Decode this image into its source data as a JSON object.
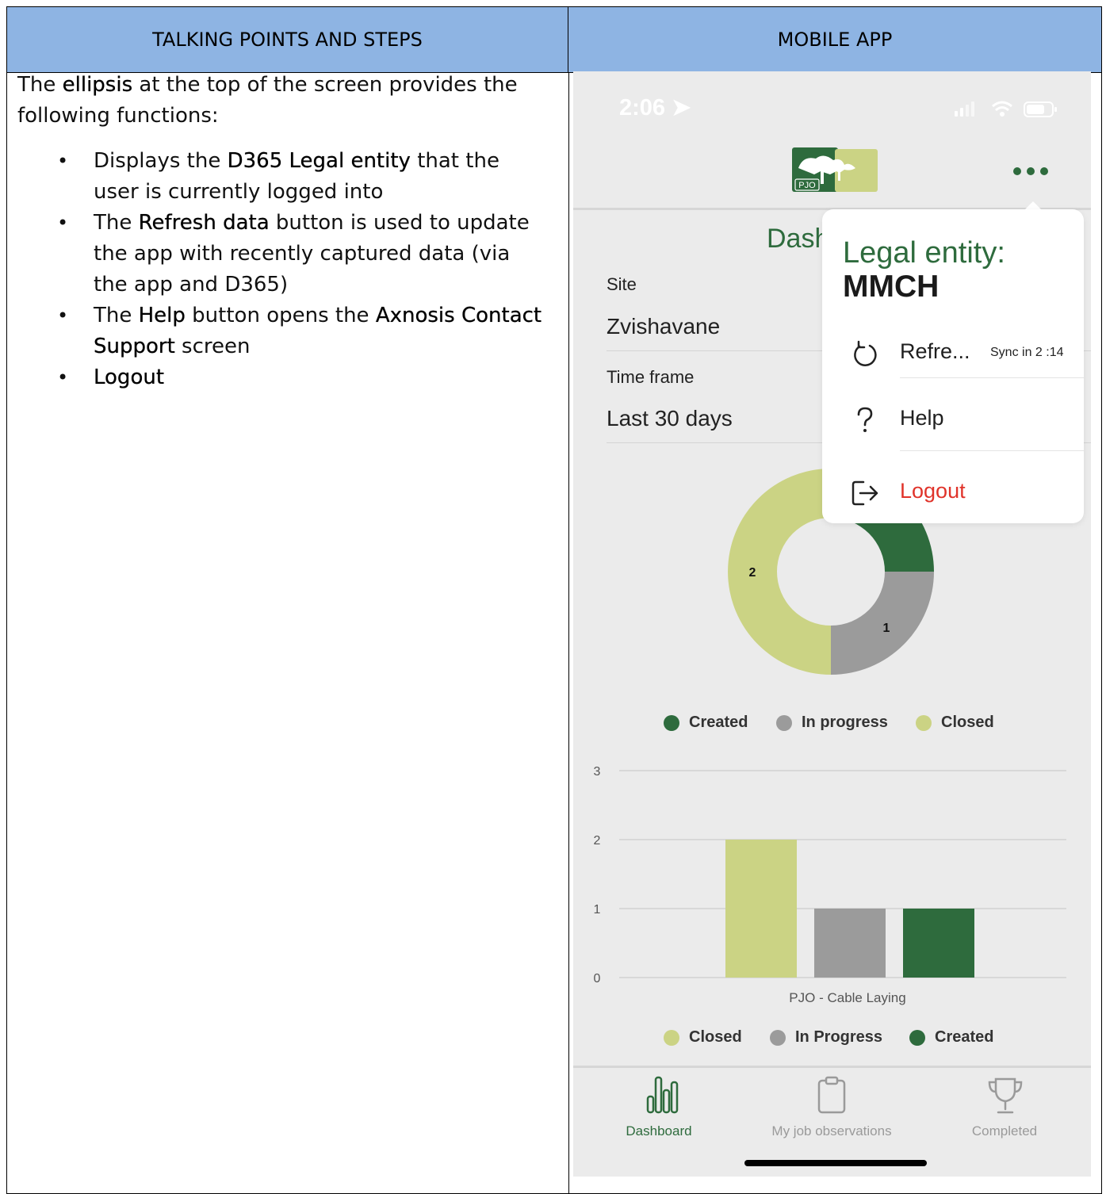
{
  "table": {
    "left_header": "TALKING POINTS AND STEPS",
    "right_header": "MOBILE APP"
  },
  "talking_points": {
    "intro_1": "The ",
    "intro_bold": "ellipsis",
    "intro_2": " at the top of the screen provides the following functions:",
    "bullets": [
      {
        "pre": "Displays the ",
        "bold": "D365 Legal entity",
        "post": " that the user is currently logged into"
      },
      {
        "pre": "The ",
        "bold": "Refresh data",
        "post": " button is used to update the app with recently captured data (via the app and D365)"
      },
      {
        "pre": "The ",
        "bold": "Help",
        "post": " button opens the ",
        "bold2": "Axnosis Contact Support",
        "post2": " screen"
      },
      {
        "pre": "",
        "bold": "Logout",
        "post": ""
      }
    ]
  },
  "phone": {
    "status_time": "2:06",
    "logo_text": "PJO",
    "page_title": "Dash",
    "site_label": "Site",
    "site_value": "Zvishavane",
    "timeframe_label": "Time frame",
    "timeframe_value": "Last 30 days",
    "popover": {
      "title": "Legal entity:",
      "entity": "MMCH",
      "refresh_label": "Refre...",
      "sync_text": "Sync in 2 :14",
      "help_label": "Help",
      "logout_label": "Logout"
    },
    "donut_legend": [
      "Created",
      "In progress",
      "Closed"
    ],
    "bar_legend": [
      "Closed",
      "In Progress",
      "Created"
    ],
    "tabs": [
      "Dashboard",
      "My job observations",
      "Completed"
    ]
  },
  "colors": {
    "created": "#2e6b3d",
    "in_progress": "#9b9b9b",
    "closed": "#cbd384",
    "header_bg": "#8eb4e3",
    "logout": "#e0332a",
    "accent": "#2e6b3d"
  },
  "chart_data": [
    {
      "type": "pie",
      "variant": "donut",
      "labels": [
        "Created",
        "In progress",
        "Closed"
      ],
      "values": [
        1,
        1,
        2
      ],
      "legend": "bottom"
    },
    {
      "type": "bar",
      "categories": [
        "PJO - Cable Laying"
      ],
      "series": [
        {
          "name": "Closed",
          "values": [
            2
          ]
        },
        {
          "name": "In Progress",
          "values": [
            1
          ]
        },
        {
          "name": "Created",
          "values": [
            1
          ]
        }
      ],
      "ylim": [
        0,
        3
      ],
      "yticks": [
        "0",
        "1",
        "2",
        "3"
      ],
      "grid": true,
      "legend": "bottom"
    }
  ]
}
